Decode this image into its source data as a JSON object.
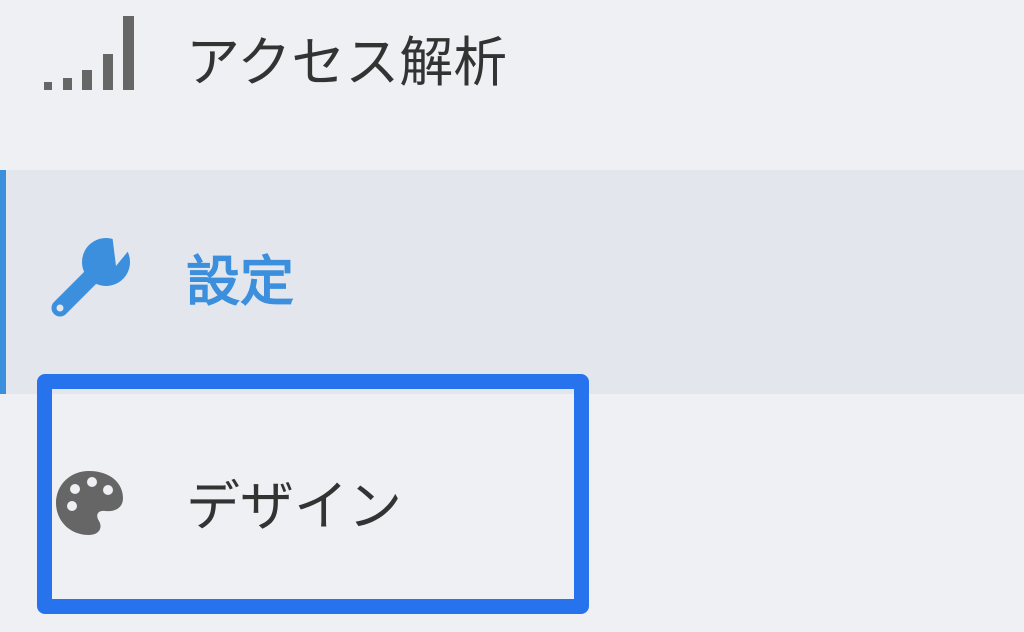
{
  "menu": {
    "items": [
      {
        "label": "アクセス解析",
        "icon": "signal-bars-icon",
        "active": false
      },
      {
        "label": "設定",
        "icon": "wrench-icon",
        "active": true
      },
      {
        "label": "デザイン",
        "icon": "palette-icon",
        "active": false
      }
    ]
  },
  "colors": {
    "background": "#eff0f3",
    "active_background": "#e3e6ed",
    "accent": "#3c8fdc",
    "text": "#333333",
    "icon": "#666666",
    "highlight_border": "#2773ee"
  }
}
